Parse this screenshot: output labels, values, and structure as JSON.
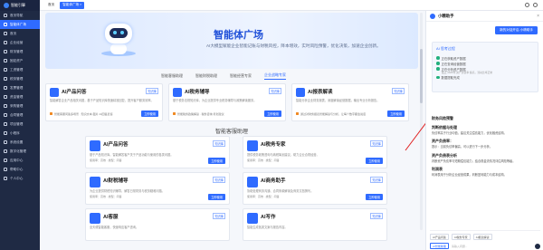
{
  "sidebar": {
    "logo": "智能引擎",
    "items": [
      {
        "label": "首页导航"
      },
      {
        "label": "智能体广场",
        "active": true
      },
      {
        "label": "首页"
      },
      {
        "label": "企业经营"
      },
      {
        "label": "财务管理"
      },
      {
        "label": "固定资产"
      },
      {
        "label": "工资管理"
      },
      {
        "label": "税务管理"
      },
      {
        "label": "发票管理"
      },
      {
        "label": "资金管理"
      },
      {
        "label": "采购管理"
      },
      {
        "label": "合同管理"
      },
      {
        "label": "项目管理"
      },
      {
        "label": "小程序"
      },
      {
        "label": "系统设置"
      },
      {
        "label": "数字化管理"
      },
      {
        "label": "应用中心"
      },
      {
        "label": "帮助中心"
      },
      {
        "label": "个人中心"
      }
    ]
  },
  "topbar": {
    "tabs": [
      {
        "label": "首页"
      },
      {
        "label": "智能体广场 ×",
        "active": true
      }
    ]
  },
  "hero": {
    "title": "智能体广场",
    "desc": "AI大模型赋能企业智能记账与财税风控，降本增效，实时风险预警，优化决策，加速企业创新。"
  },
  "subtabs": [
    {
      "label": "智能客服助理"
    },
    {
      "label": "智能财税助理"
    },
    {
      "label": "智能经营专家"
    },
    {
      "label": "企业战略专家",
      "active": true
    }
  ],
  "featured": [
    {
      "title": "AI产品问答",
      "badge": "知识库",
      "desc": "智能解答企业产品相关问题，基于产品知识库快速精准回复，提升客户服务效率。",
      "foot": "智能客服问答多场景 · 知识文本·图片·AI回答反馈",
      "btn": "立即使用"
    },
    {
      "title": "AI税务辅导",
      "badge": "知识库",
      "desc": "基于税务法规知识库，为企业提供专业税务辅导与政策解读服务。",
      "foot": "智能税务政策解读 · 税务咨询·筹划建议",
      "btn": "立即使用"
    },
    {
      "title": "AI报表解读",
      "badge": "知识库",
      "desc": "智能分析企业财务报表，深度解读经营数据，输出专业分析报告。",
      "foot": "通过对财务报表智能解读与分析，让每个数字都会说话",
      "btn": "立即使用"
    }
  ],
  "section_title": "智能客服助理",
  "agents": [
    {
      "title": "AI产品问答",
      "badge": "知识库",
      "desc": "基于产品知识库，智能解答客户关于产品功能与使用的各类问题。",
      "meta": "使用率：高效 · 类型：问答",
      "btn": "立即使用"
    },
    {
      "title": "AI税务专家",
      "badge": "知识库",
      "desc": "提供税务政策咨询与纳税筹划建议，助力企业合规经营。",
      "meta": "使用率：高效 · 类型：问答",
      "btn": "立即使用"
    },
    {
      "title": "AI财税辅导",
      "badge": "知识库",
      "desc": "为企业提供财税知识辅导，解答日常财务与税务疑难问题。",
      "meta": "使用率：高效 · 类型：问答",
      "btn": "立即使用"
    },
    {
      "title": "AI商务助手",
      "badge": "知识库",
      "desc": "协助处理商务沟通、合同条款解读及商务文档撰写。",
      "meta": "使用率：高效 · 类型：问答",
      "btn": "立即使用"
    },
    {
      "title": "AI客服",
      "badge": "知识库",
      "desc": "全天候智能客服，快速响应客户咨询。",
      "meta": "使用率：高效 · 类型：问答",
      "btn": "立即使用"
    },
    {
      "title": "AI写作",
      "badge": "知识库",
      "desc": "智能生成各类文案与报告内容。",
      "meta": "使用率：高效 · 类型：问答",
      "btn": "立即使用"
    }
  ],
  "assistant": {
    "title": "小精助手",
    "close": "×",
    "new_btn": "新的对话开启 小精助手",
    "box_title": "AI 思考过程",
    "steps": [
      {
        "label": "正在获取资产数据"
      },
      {
        "label": "正在查询经营数据"
      },
      {
        "label": "正在分析资产数据",
        "note": "截止 2025年 资产负债率 偏高，流动比率正常"
      },
      {
        "label": "数据提取完成"
      }
    ],
    "sections": [
      {
        "h": "财务风险预警",
        "p": ""
      },
      {
        "h": "判断依据与处理",
        "p": "负债率高于行业均值，建议关注偿债能力，优化融资结构。"
      },
      {
        "h": "资产负债率：",
        "p": "提示：当前负债率偏高，可以进行下一步分析。"
      },
      {
        "h": "资产负债表分析",
        "p": "判断资产负债率与短期偿债能力，结合现金流情况评估风险等级。"
      },
      {
        "h": "利润表",
        "p": "利润表用于分析企业经营成果，判断盈利能力与成本结构。"
      }
    ],
    "chips": [
      "AI产品问答",
      "AI税务专家",
      "AI报表解读"
    ],
    "mode": "AI智能助理",
    "placeholder": "请输入问题..."
  },
  "colors": {
    "accent": "#2f6bff",
    "sidebar": "#1f2a44",
    "annotation": "#e02020"
  }
}
